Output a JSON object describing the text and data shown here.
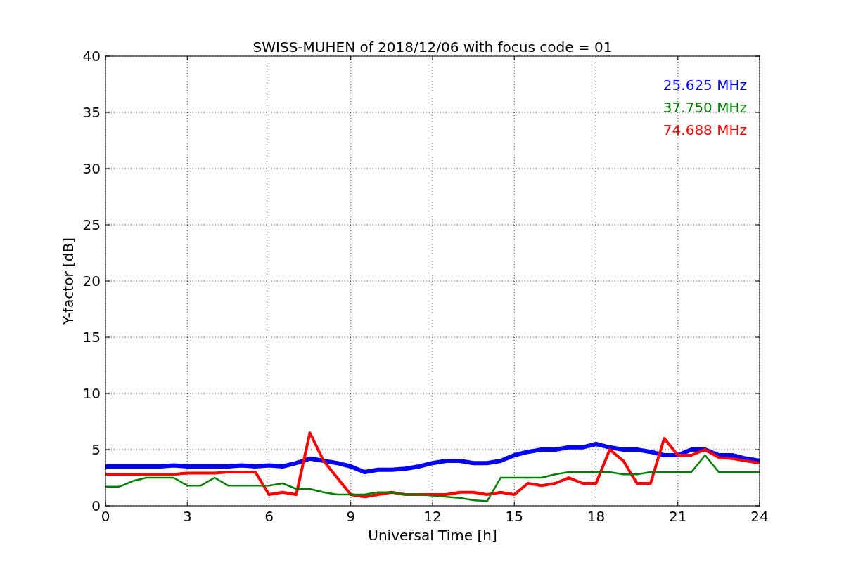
{
  "figure": {
    "chart_data": {
      "type": "line",
      "title": "SWISS-MUHEN of 2018/12/06 with focus code = 01",
      "xlabel": "Universal Time [h]",
      "ylabel": "Y-factor [dB]",
      "x": [
        0,
        0.5,
        1,
        1.5,
        2,
        2.5,
        3,
        3.5,
        4,
        4.5,
        5,
        5.5,
        6,
        6.5,
        7,
        7.5,
        8,
        8.5,
        9,
        9.5,
        10,
        10.5,
        11,
        11.5,
        12,
        12.5,
        13,
        13.5,
        14,
        14.5,
        15,
        15.5,
        16,
        16.5,
        17,
        17.5,
        18,
        18.5,
        19,
        19.5,
        20,
        20.5,
        21,
        21.5,
        22,
        22.5,
        23,
        23.5,
        24
      ],
      "series": [
        {
          "name": "25.625 MHz",
          "color": "#0000ff",
          "values": [
            3.5,
            3.5,
            3.5,
            3.5,
            3.5,
            3.6,
            3.5,
            3.5,
            3.5,
            3.5,
            3.6,
            3.5,
            3.6,
            3.5,
            3.8,
            4.2,
            4.0,
            3.8,
            3.5,
            3.0,
            3.2,
            3.2,
            3.3,
            3.5,
            3.8,
            4.0,
            4.0,
            3.8,
            3.8,
            4.0,
            4.5,
            4.8,
            5.0,
            5.0,
            5.2,
            5.2,
            5.5,
            5.2,
            5.0,
            5.0,
            4.8,
            4.5,
            4.5,
            5.0,
            5.0,
            4.5,
            4.5,
            4.2,
            4.0
          ]
        },
        {
          "name": "37.750 MHz",
          "color": "#008000",
          "values": [
            1.7,
            1.7,
            2.2,
            2.5,
            2.5,
            2.5,
            1.8,
            1.8,
            2.5,
            1.8,
            1.8,
            1.8,
            1.8,
            2.0,
            1.5,
            1.5,
            1.2,
            1.0,
            1.0,
            1.0,
            1.2,
            1.2,
            1.0,
            1.0,
            0.9,
            0.8,
            0.7,
            0.5,
            0.4,
            2.5,
            2.5,
            2.5,
            2.5,
            2.8,
            3.0,
            3.0,
            3.0,
            3.0,
            2.8,
            2.8,
            3.0,
            3.0,
            3.0,
            3.0,
            4.5,
            3.0,
            3.0,
            3.0,
            3.0
          ]
        },
        {
          "name": "74.688 MHz",
          "color": "#ff0000",
          "values": [
            2.8,
            2.8,
            2.8,
            2.8,
            2.8,
            2.8,
            2.9,
            2.9,
            2.9,
            3.0,
            3.0,
            3.0,
            1.0,
            1.2,
            1.0,
            6.5,
            4.0,
            2.5,
            1.0,
            0.8,
            1.0,
            1.2,
            1.0,
            1.0,
            1.0,
            1.0,
            1.2,
            1.2,
            1.0,
            1.2,
            1.0,
            2.0,
            1.8,
            2.0,
            2.5,
            2.0,
            2.0,
            5.0,
            4.0,
            2.0,
            2.0,
            6.0,
            4.5,
            4.5,
            5.0,
            4.3,
            4.2,
            4.0,
            3.8
          ]
        }
      ],
      "grid": true,
      "xlim": [
        0,
        24
      ],
      "ylim": [
        0,
        40
      ],
      "xticks": [
        0,
        3,
        6,
        9,
        12,
        15,
        18,
        21,
        24
      ],
      "yticks": [
        0,
        5,
        10,
        15,
        20,
        25,
        30,
        35,
        40
      ]
    }
  }
}
